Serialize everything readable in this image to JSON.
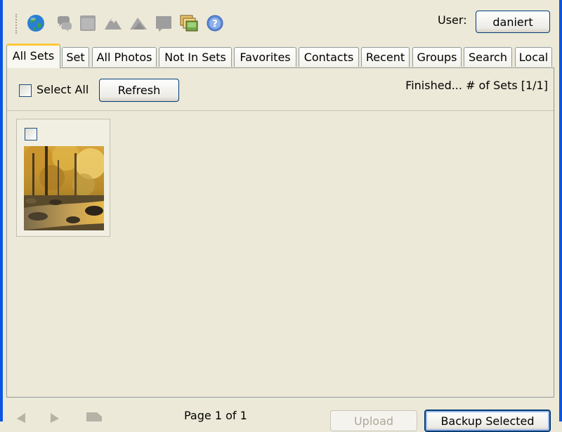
{
  "toolbar": {
    "icons": [
      "globe-icon",
      "speech-bubble-icon",
      "window-icon",
      "mountain-icon",
      "mountain-alt-icon",
      "folder-icon",
      "stacked-photos-icon",
      "help-icon"
    ],
    "user_label": "User:",
    "user_name": "daniert"
  },
  "tabs": [
    {
      "label": "All Sets",
      "active": true
    },
    {
      "label": "Set"
    },
    {
      "label": "All Photos"
    },
    {
      "label": "Not In Sets"
    },
    {
      "label": "Favorites"
    },
    {
      "label": "Contacts"
    },
    {
      "label": "Recent"
    },
    {
      "label": "Groups"
    },
    {
      "label": "Search"
    },
    {
      "label": "Local"
    }
  ],
  "subbar": {
    "select_all_label": "Select All",
    "refresh_label": "Refresh",
    "status": "Finished...  # of Sets [1/1]"
  },
  "thumbnails": [
    {
      "selected": false,
      "icon": "autumn-forest-stream-photo"
    }
  ],
  "footer": {
    "page_text": "Page 1 of 1",
    "upload_label": "Upload",
    "backup_label": "Backup Selected"
  },
  "colors": {
    "window_frame": "#0A55E3",
    "background": "#ECE9D8",
    "active_tab_accent": "#FFC83C",
    "button_border": "#003C74"
  }
}
